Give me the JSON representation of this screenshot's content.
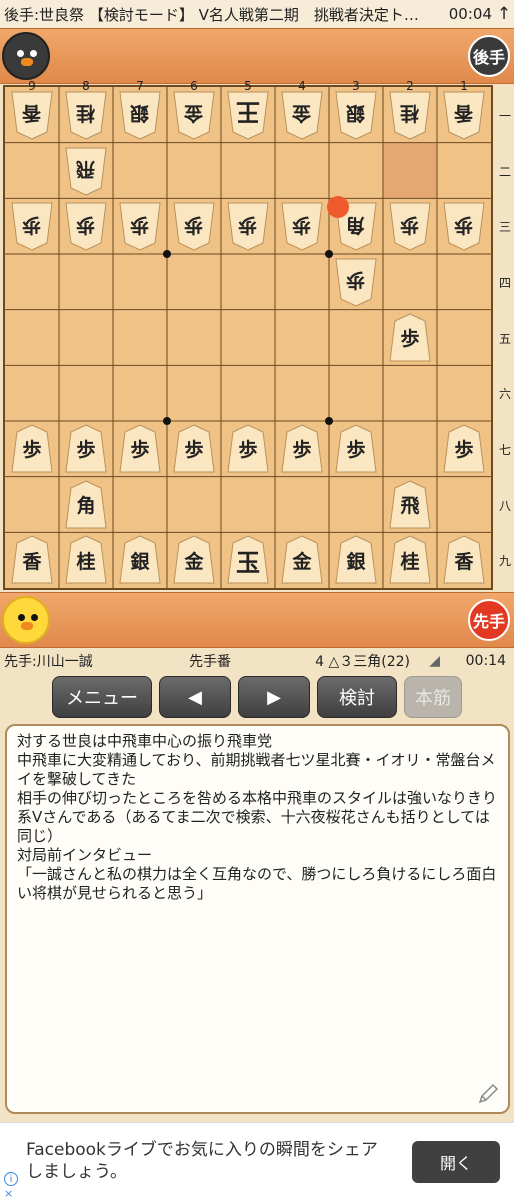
{
  "topbar": {
    "title": "後手:世良祭 【検討モード】 V名人戦第二期　挑戦者決定トー…",
    "time": "00:04",
    "updown_icon": "↑"
  },
  "gote": {
    "badge": "後手",
    "avatar": "crow-avatar"
  },
  "sente": {
    "badge": "先手",
    "avatar": "chick-avatar"
  },
  "board": {
    "files": [
      "9",
      "8",
      "7",
      "6",
      "5",
      "4",
      "3",
      "2",
      "1"
    ],
    "ranks": [
      "一",
      "二",
      "三",
      "四",
      "五",
      "六",
      "七",
      "八",
      "九"
    ],
    "pieces": [
      {
        "file": 9,
        "rank": 1,
        "char": "香",
        "side": "gote"
      },
      {
        "file": 8,
        "rank": 1,
        "char": "桂",
        "side": "gote"
      },
      {
        "file": 7,
        "rank": 1,
        "char": "銀",
        "side": "gote"
      },
      {
        "file": 6,
        "rank": 1,
        "char": "金",
        "side": "gote"
      },
      {
        "file": 5,
        "rank": 1,
        "char": "王",
        "side": "gote"
      },
      {
        "file": 4,
        "rank": 1,
        "char": "金",
        "side": "gote"
      },
      {
        "file": 3,
        "rank": 1,
        "char": "銀",
        "side": "gote"
      },
      {
        "file": 2,
        "rank": 1,
        "char": "桂",
        "side": "gote"
      },
      {
        "file": 1,
        "rank": 1,
        "char": "香",
        "side": "gote"
      },
      {
        "file": 8,
        "rank": 2,
        "char": "飛",
        "side": "gote"
      },
      {
        "file": 9,
        "rank": 3,
        "char": "歩",
        "side": "gote"
      },
      {
        "file": 8,
        "rank": 3,
        "char": "歩",
        "side": "gote"
      },
      {
        "file": 7,
        "rank": 3,
        "char": "歩",
        "side": "gote"
      },
      {
        "file": 6,
        "rank": 3,
        "char": "歩",
        "side": "gote"
      },
      {
        "file": 5,
        "rank": 3,
        "char": "歩",
        "side": "gote"
      },
      {
        "file": 4,
        "rank": 3,
        "char": "歩",
        "side": "gote"
      },
      {
        "file": 3,
        "rank": 3,
        "char": "角",
        "side": "gote"
      },
      {
        "file": 2,
        "rank": 3,
        "char": "歩",
        "side": "gote"
      },
      {
        "file": 1,
        "rank": 3,
        "char": "歩",
        "side": "gote"
      },
      {
        "file": 3,
        "rank": 4,
        "char": "歩",
        "side": "gote"
      },
      {
        "file": 2,
        "rank": 5,
        "char": "歩",
        "side": "sente"
      },
      {
        "file": 9,
        "rank": 7,
        "char": "歩",
        "side": "sente"
      },
      {
        "file": 8,
        "rank": 7,
        "char": "歩",
        "side": "sente"
      },
      {
        "file": 7,
        "rank": 7,
        "char": "歩",
        "side": "sente"
      },
      {
        "file": 6,
        "rank": 7,
        "char": "歩",
        "side": "sente"
      },
      {
        "file": 5,
        "rank": 7,
        "char": "歩",
        "side": "sente"
      },
      {
        "file": 4,
        "rank": 7,
        "char": "歩",
        "side": "sente"
      },
      {
        "file": 3,
        "rank": 7,
        "char": "歩",
        "side": "sente"
      },
      {
        "file": 1,
        "rank": 7,
        "char": "歩",
        "side": "sente"
      },
      {
        "file": 8,
        "rank": 8,
        "char": "角",
        "side": "sente"
      },
      {
        "file": 2,
        "rank": 8,
        "char": "飛",
        "side": "sente"
      },
      {
        "file": 9,
        "rank": 9,
        "char": "香",
        "side": "sente"
      },
      {
        "file": 8,
        "rank": 9,
        "char": "桂",
        "side": "sente"
      },
      {
        "file": 7,
        "rank": 9,
        "char": "銀",
        "side": "sente"
      },
      {
        "file": 6,
        "rank": 9,
        "char": "金",
        "side": "sente"
      },
      {
        "file": 5,
        "rank": 9,
        "char": "玉",
        "side": "sente"
      },
      {
        "file": 4,
        "rank": 9,
        "char": "金",
        "side": "sente"
      },
      {
        "file": 3,
        "rank": 9,
        "char": "銀",
        "side": "sente"
      },
      {
        "file": 2,
        "rank": 9,
        "char": "桂",
        "side": "sente"
      },
      {
        "file": 1,
        "rank": 9,
        "char": "香",
        "side": "sente"
      }
    ],
    "last_move_from": {
      "file": 2,
      "rank": 2
    },
    "last_move_to": {
      "file": 3,
      "rank": 3
    },
    "colors": {
      "board": "#f0c285",
      "highlight": "#e4a873",
      "move_marker": "#ee5a2a"
    }
  },
  "info": {
    "sente_name": "先手:川山一誠",
    "side_to_move": "先手番",
    "last_move": "4 △３三角(22)",
    "clock": "00:14"
  },
  "buttons": {
    "menu": "メニュー",
    "prev_icon": "◀",
    "next_icon": "▶",
    "analyze": "検討",
    "mainline": "本筋"
  },
  "comment": {
    "text": "対する世良は中飛車中心の振り飛車党\n中飛車に大変精通しており、前期挑戦者七ツ星北賽・イオリ・常盤台メイを撃破してきた\n相手の伸び切ったところを咎める本格中飛車のスタイルは強いなりきり系Vさんである（あるてま二次で検索、十六夜桜花さんも括りとしては同じ）\n対局前インタビュー\n「一誠さんと私の棋力は全く互角なので、勝つにしろ負けるにしろ面白い将棋が見せられると思う」"
  },
  "ad": {
    "text": "Facebookライブでお気に入りの瞬間をシェアしましょう。",
    "open_button": "開く",
    "info_icon": "i",
    "close_icon": "×"
  }
}
